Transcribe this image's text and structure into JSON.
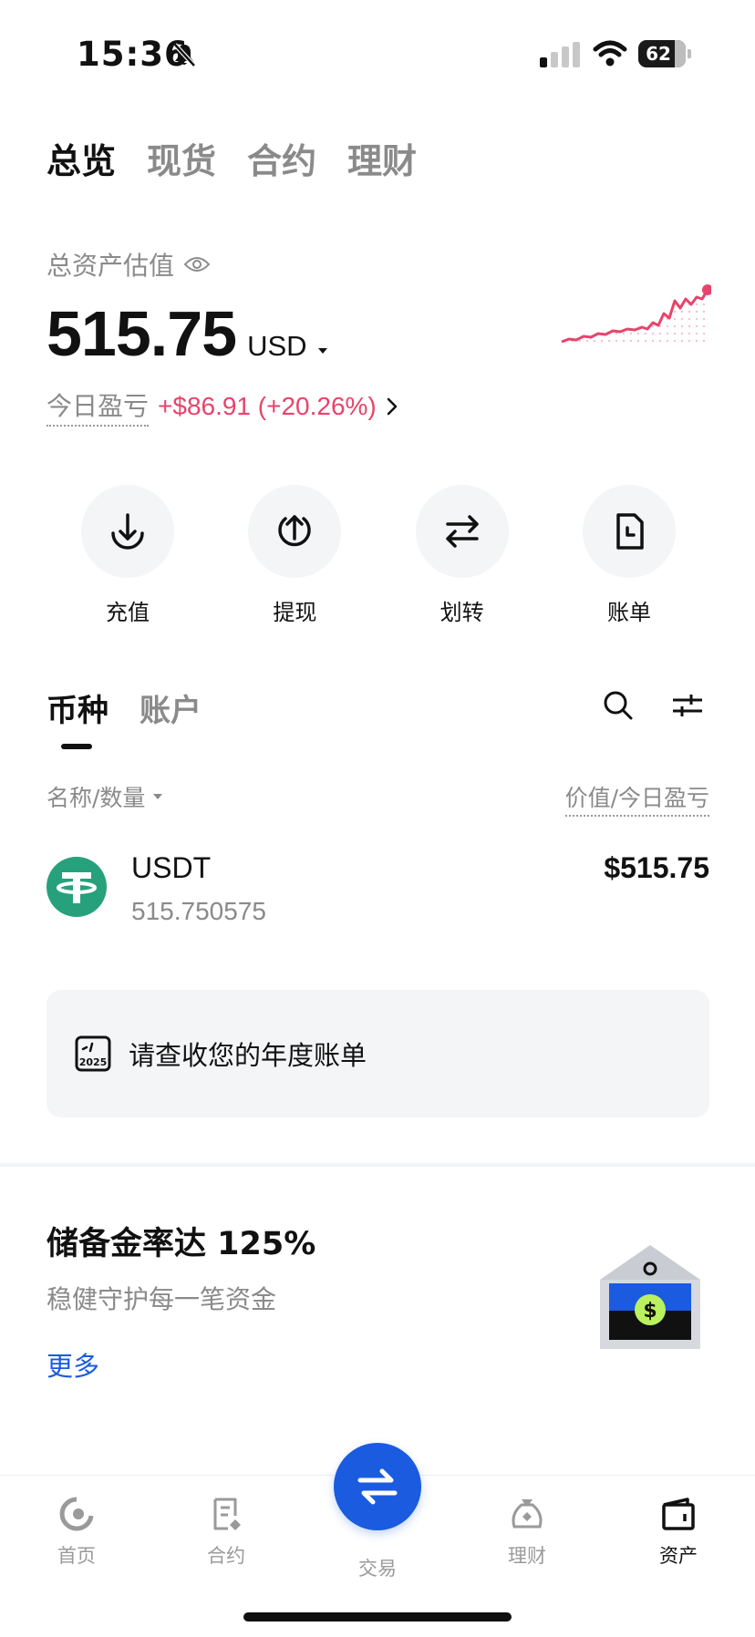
{
  "status_bar": {
    "time": "15:36",
    "battery": "62"
  },
  "top_tabs": [
    {
      "label": "总览"
    },
    {
      "label": "现货"
    },
    {
      "label": "合约"
    },
    {
      "label": "理财"
    }
  ],
  "balance": {
    "label": "总资产估值",
    "value": "515.75",
    "currency": "USD",
    "pnl_label": "今日盈亏",
    "pnl_value": "+$86.91 (+20.26%)"
  },
  "actions": [
    {
      "label": "充值",
      "icon": "deposit-icon"
    },
    {
      "label": "提现",
      "icon": "withdraw-icon"
    },
    {
      "label": "划转",
      "icon": "transfer-icon"
    },
    {
      "label": "账单",
      "icon": "bill-icon"
    }
  ],
  "asset_tabs": [
    {
      "label": "币种"
    },
    {
      "label": "账户"
    }
  ],
  "list_header": {
    "left": "名称/数量",
    "right": "价值/今日盈亏"
  },
  "coins": [
    {
      "symbol": "USDT",
      "amount": "515.750575",
      "value": "$515.75"
    }
  ],
  "annual_bill": {
    "text": "请查收您的年度账单",
    "year": "2025"
  },
  "reserve": {
    "title": "储备金率达 125%",
    "subtitle": "稳健守护每一笔资金",
    "more": "更多"
  },
  "bottom_nav": [
    {
      "label": "首页",
      "icon": "home-icon"
    },
    {
      "label": "合约",
      "icon": "futures-icon"
    },
    {
      "label": "交易",
      "icon": "trade-icon"
    },
    {
      "label": "理财",
      "icon": "earn-icon"
    },
    {
      "label": "资产",
      "icon": "assets-icon"
    }
  ],
  "colors": {
    "accent": "#1a5be0",
    "gain": "#e8436a",
    "usdt": "#26a17b"
  }
}
